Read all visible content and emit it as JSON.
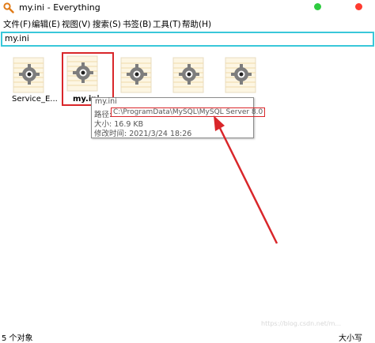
{
  "window": {
    "title": "my.ini - Everything"
  },
  "menu": [
    "文件(F)",
    "编辑(E)",
    "视图(V)",
    "搜索(S)",
    "书签(B)",
    "工具(T)",
    "帮助(H)"
  ],
  "search": {
    "value": "my.ini"
  },
  "files": [
    {
      "label": "Service_E..."
    },
    {
      "label": "my.ini"
    },
    {
      "label": ""
    },
    {
      "label": ""
    },
    {
      "label": ""
    }
  ],
  "tooltip": {
    "name": "my.ini",
    "path_label": "路径:",
    "path_value": "C:\\ProgramData\\MySQL\\MySQL Server 8.0",
    "size_label": "大小:",
    "size_value": "16.9 KB",
    "modified_label": "修改时间:",
    "modified_value": "2021/3/24 18:26"
  },
  "status": {
    "count": "5 个对象",
    "size_mode": "大小写"
  },
  "watermark": "https://blog.csdn.net/m...",
  "colors": {
    "accent": "#39c7d9",
    "highlight": "#d9262a"
  }
}
